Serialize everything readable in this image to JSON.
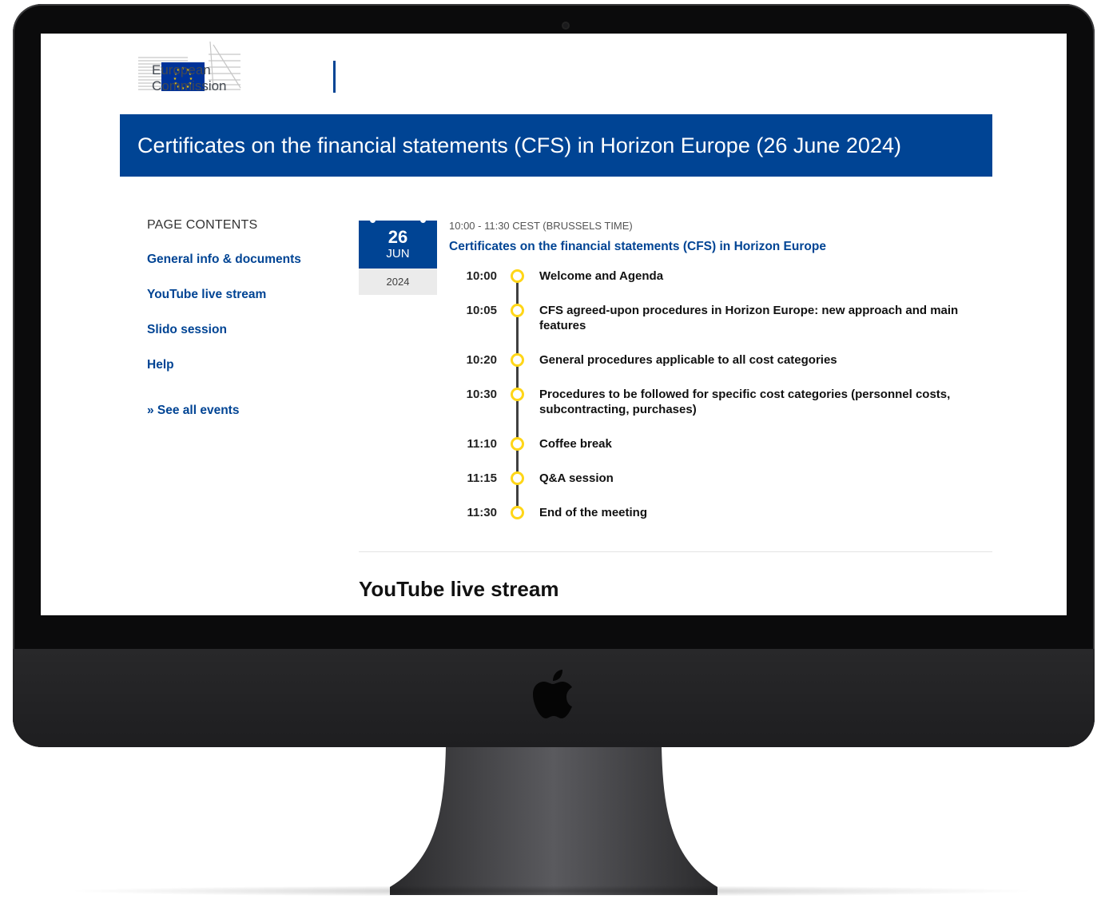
{
  "header": {
    "logo_line1": "European",
    "logo_line2": "Commission",
    "page_title": "Certificates on the financial statements (CFS) in Horizon Europe (26 June 2024)"
  },
  "sidebar": {
    "title": "PAGE CONTENTS",
    "items": [
      {
        "label": "General info & documents"
      },
      {
        "label": "YouTube live stream"
      },
      {
        "label": "Slido session"
      },
      {
        "label": "Help"
      }
    ],
    "see_all": "» See all events"
  },
  "event": {
    "date": {
      "day": "26",
      "month": "JUN",
      "year": "2024"
    },
    "time_range": "10:00 - 11:30 CEST (BRUSSELS TIME)",
    "title": "Certificates on the financial statements (CFS) in Horizon Europe",
    "agenda": [
      {
        "time": "10:00",
        "label": "Welcome and Agenda"
      },
      {
        "time": "10:05",
        "label": "CFS agreed-upon procedures in Horizon Europe: new approach and main features"
      },
      {
        "time": "10:20",
        "label": "General procedures applicable to all cost categories"
      },
      {
        "time": "10:30",
        "label": "Procedures to be followed for specific cost categories (personnel costs, subcontracting, purchases)"
      },
      {
        "time": "11:10",
        "label": "Coffee break"
      },
      {
        "time": "11:15",
        "label": "Q&A session"
      },
      {
        "time": "11:30",
        "label": "End of the meeting"
      }
    ]
  },
  "section_heading": "YouTube live stream",
  "colors": {
    "brand_blue": "#004494",
    "timeline_dot": "#ffd617",
    "eu_flag": "#003399",
    "eu_star": "#ffcc00"
  }
}
